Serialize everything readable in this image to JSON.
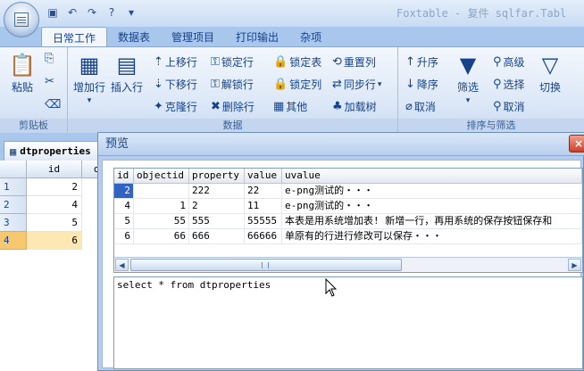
{
  "titlebar": {
    "window_title": "Foxtable - 复件 sqlfar.Tabl"
  },
  "ribbon_tabs": [
    "日常工作",
    "数据表",
    "管理项目",
    "打印输出",
    "杂项"
  ],
  "ribbon": {
    "clipboard": {
      "label": "剪贴板",
      "paste": "粘贴"
    },
    "data": {
      "label": "数据",
      "add_row": "增加行",
      "insert_row": "插入行",
      "move_up": "上移行",
      "move_down": "下移行",
      "clone_row": "克隆行",
      "lock_row": "锁定行",
      "unlock_row": "解锁行",
      "delete_row": "删除行",
      "lock_table": "锁定表",
      "lock_column": "锁定列",
      "other": "其他",
      "reset_column": "重置列",
      "sync_row": "同步行",
      "load_tree": "加载树"
    },
    "sort_filter": {
      "label": "排序与筛选",
      "ascending": "升序",
      "descending": "降序",
      "cancel_sort": "取消",
      "filter": "筛选",
      "advanced": "高级",
      "select": "选择",
      "cancel_filter": "取消",
      "switch": "切换"
    }
  },
  "document": {
    "tab_label": "dtproperties",
    "columns": [
      "id",
      "ob"
    ],
    "rows": [
      {
        "num": "1",
        "id": "2"
      },
      {
        "num": "2",
        "id": "4"
      },
      {
        "num": "3",
        "id": "5"
      },
      {
        "num": "4",
        "id": "6"
      }
    ]
  },
  "preview": {
    "title": "预览",
    "close": "×",
    "columns": [
      "id",
      "objectid",
      "property",
      "value",
      "uvalue"
    ],
    "rows": [
      {
        "id": "2",
        "objectid": "",
        "property": "222",
        "value": "22",
        "uvalue": "e-png测试的・・・"
      },
      {
        "id": "4",
        "objectid": "1",
        "property": "2",
        "value": "11",
        "uvalue": "e-png测试的・・・"
      },
      {
        "id": "5",
        "objectid": "55",
        "property": "555",
        "value": "55555",
        "uvalue": "本表是用系统增加表!  新增一行，再用系统的保存按钮保存和"
      },
      {
        "id": "6",
        "objectid": "66",
        "property": "666",
        "value": "66666",
        "uvalue": "单原有的行进行修改可以保存・・・"
      }
    ],
    "sql": "select * from dtproperties"
  },
  "colors": {
    "ribbon_bg": "#dbe7f7",
    "selection": "#3163c5",
    "active_row_header": "#f7c86e"
  }
}
